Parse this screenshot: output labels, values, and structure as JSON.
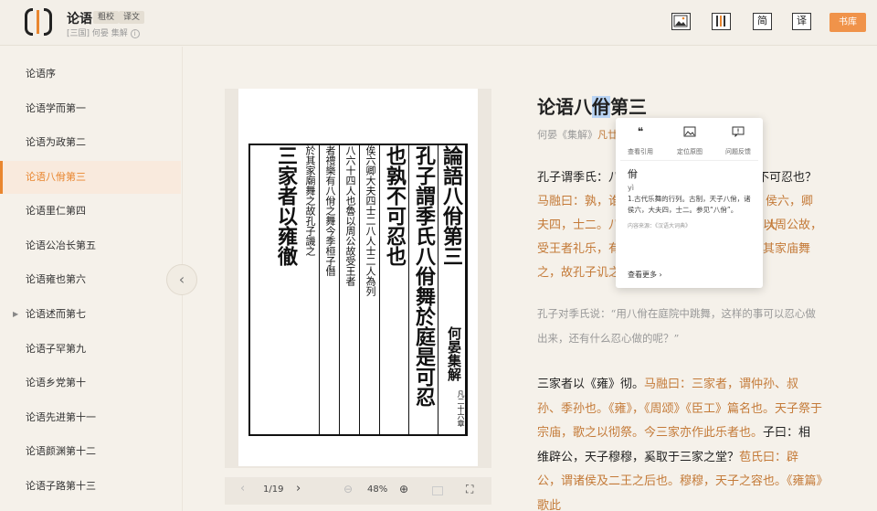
{
  "header": {
    "title": "论语",
    "chips": [
      "粗校",
      "译文"
    ],
    "subtitle": "[三国] 何晏 集解",
    "library_label": "书库",
    "btn_simplified": "简",
    "btn_translate": "译"
  },
  "sidebar": {
    "items": [
      {
        "label": "论语序"
      },
      {
        "label": "论语学而第一"
      },
      {
        "label": "论语为政第二"
      },
      {
        "label": "论语八佾第三"
      },
      {
        "label": "论语里仁第四"
      },
      {
        "label": "论语公冶长第五"
      },
      {
        "label": "论语雍也第六"
      },
      {
        "label": "论语述而第七"
      },
      {
        "label": "论语子罕第九"
      },
      {
        "label": "论语乡党第十"
      },
      {
        "label": "论语先进第十一"
      },
      {
        "label": "论语颜渊第十二"
      },
      {
        "label": "论语子路第十三"
      }
    ],
    "active_index": 3
  },
  "scan": {
    "columns": [
      {
        "text": "論語八佾第三",
        "size": "big"
      },
      {
        "text": "孔子謂季氏八佾舞於庭是可忍",
        "size": "big"
      },
      {
        "text": "也孰不可忍也",
        "size": "big"
      },
      {
        "text": "俟六卿大夫四士二八人士二人為列",
        "size": "small"
      },
      {
        "text": "八六十四人也魯以周公故受王者",
        "size": "small"
      },
      {
        "text": "者禮樂有八佾之舞今季桓子僭",
        "size": "small"
      },
      {
        "text": "於其家廟舞之故孔子譏之",
        "size": "small"
      },
      {
        "text": "三家者以雍徹",
        "size": "big"
      }
    ],
    "right_caption": "何晏集解",
    "right_caption_small": "凡二十六章",
    "page_indicator": "1/19",
    "zoom": "48%"
  },
  "reading": {
    "heading_pre": "论语八",
    "heading_hl": "佾",
    "heading_post": "第三",
    "byline_gray": "何晏《集解》",
    "byline_orange": "凡廿",
    "p1_line1": "孔子谓季氏：八",
    "p1_line1_end": "不可忍也？",
    "p1_notes": [
      "马融曰：孰，谁",
      "侯六，卿大",
      "夫四，士二。八",
      "以周公故，",
      "受王者礼乐，有",
      "于其家庙舞",
      "之，故孔子讥之也。"
    ],
    "p2": "孔子对季氏说：“用八佾在庭院中跳舞，这样的事可以忍心做出来，还有什么忍心做的呢？”",
    "p3_main1": "三家者以《雍》彻。",
    "p3_note1": "马融曰：三家者，谓仲孙、叔孙、季孙也。《雍》，《周颂》《臣工》篇名也。天子祭于宗庙，歌之以彻祭。今三家亦作此乐者也。",
    "p3_main2": "子曰：相维辟公，天子穆穆，奚取于三家之堂？",
    "p3_note2": "苞氏曰：辟公，谓诸侯及二王之后也。穆穆，天子之容也。《雍篇》歌此"
  },
  "popup": {
    "actions": [
      {
        "label": "查看引用",
        "icon": "quote-icon"
      },
      {
        "label": "定位原图",
        "icon": "image-icon"
      },
      {
        "label": "问题反馈",
        "icon": "feedback-icon"
      }
    ],
    "word": "佾",
    "pinyin": "yì",
    "definition": "1.古代乐舞的行列。古制，天子八佾，诸侯六，大夫四，士二。参见“八佾”。",
    "source": "内容来源：《汉语大词典》",
    "more_label": "查看更多"
  }
}
